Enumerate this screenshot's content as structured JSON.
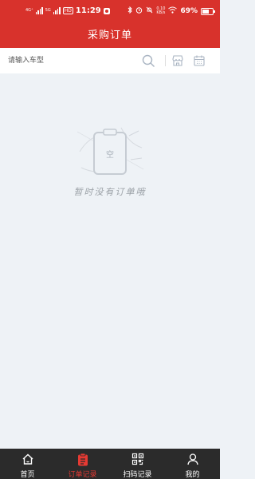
{
  "status_bar": {
    "network_left": "4G⁺",
    "network_right": "5G",
    "hd": "HD",
    "time": "11:29",
    "speed_value": "0.10",
    "speed_unit": "KB/s",
    "battery": "69%"
  },
  "header": {
    "title": "采购订单"
  },
  "search": {
    "placeholder": "请输入车型",
    "value": ""
  },
  "empty_state": {
    "text": "暂时没有订单哦",
    "illustration_char": "空"
  },
  "tabbar": {
    "items": [
      {
        "label": "首页",
        "icon": "home-icon",
        "active": false
      },
      {
        "label": "订单记录",
        "icon": "order-record-icon",
        "active": true
      },
      {
        "label": "扫码记录",
        "icon": "qr-code-icon",
        "active": false
      },
      {
        "label": "我的",
        "icon": "profile-icon",
        "active": false
      }
    ]
  },
  "colors": {
    "brand_red": "#d8322c",
    "active_tab": "#e63a33",
    "tabbar_bg": "#2b2b2b",
    "page_bg": "#eef2f6"
  }
}
